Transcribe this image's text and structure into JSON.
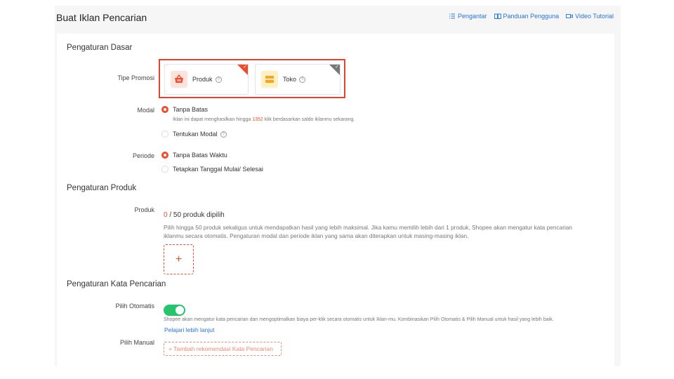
{
  "header": {
    "title": "Buat Iklan Pencarian",
    "links": {
      "intro": "Pengantar",
      "guide": "Panduan Pengguna",
      "video": "Video Tutorial"
    }
  },
  "basic": {
    "section_title": "Pengaturan Dasar",
    "promo_type_label": "Tipe Promosi",
    "promo_options": [
      {
        "label": "Produk",
        "selected": true
      },
      {
        "label": "Toko",
        "selected": false
      }
    ],
    "budget_label": "Modal",
    "budget_unlimited": "Tanpa Batas",
    "budget_note_prefix": "Iklan ini dapat menghasilkan hingga ",
    "budget_note_clicks": "1352",
    "budget_note_suffix": " klik berdasarkan saldo iklanmu sekarang.",
    "budget_set": "Tentukan Modal",
    "period_label": "Periode",
    "period_unlimited": "Tanpa Batas Waktu",
    "period_set": "Tetapkan Tanggal Mulai/ Selesai"
  },
  "product": {
    "section_title": "Pengaturan Produk",
    "label": "Produk",
    "count": "0",
    "count_suffix": " / 50 produk dipilih",
    "description": "Pilih hingga 50 produk sekaligus untuk mendapatkan hasil yang lebih maksimal. Jika kamu memilih lebih dari 1 produk, Shopee akan mengatur kata pencarian iklanmu secara otomatis. Pengaturan modal dan periode iklan yang sama akan diterapkan untuk masing-masing iklan.",
    "add_symbol": "+"
  },
  "keyword": {
    "section_title": "Pengaturan Kata Pencarian",
    "auto_label": "Pilih Otomatis",
    "auto_enabled": true,
    "auto_note": "Shopee akan mengatur kata pencarian dan mengoptimalkan biaya per-klik secara otomatis untuk Iklan-mu. Kombinasikan Pilih Otomatis & Pilih Manual untuk hasil yang lebih baik.",
    "learn_more": "Pelajari lebih lanjut",
    "manual_label": "Pilih Manual",
    "add_keyword": "+ Tambah rekomendasi Kata Pencarian"
  },
  "colors": {
    "accent": "#ee4d2d",
    "link": "#2673dd",
    "toggle_on": "#26c46b"
  }
}
